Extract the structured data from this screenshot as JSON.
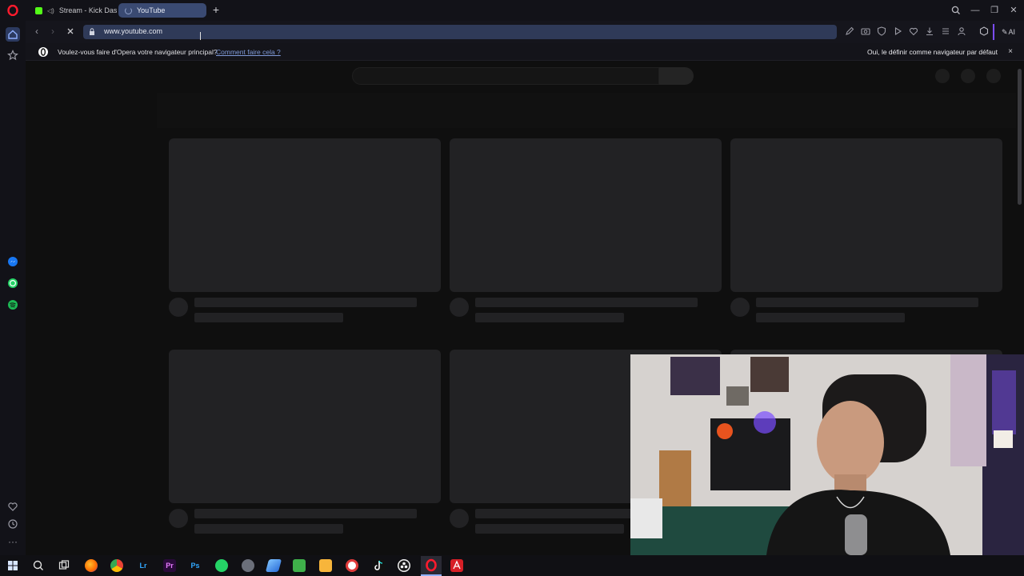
{
  "browser": {
    "tabs": [
      {
        "label": "Stream - Kick Dashbo"
      },
      {
        "label": "YouTube"
      }
    ],
    "address": {
      "url": "www.youtube.com"
    }
  },
  "banner": {
    "message": "Voulez-vous faire d'Opera votre navigateur principal?",
    "link": "Comment faire cela ?",
    "button": "Oui, le définir comme navigateur par défaut",
    "close": "×"
  },
  "toolbar": {
    "ai_label": "AI"
  },
  "taskbar": {
    "apps": [
      "Lr",
      "Pr",
      "Ps"
    ]
  },
  "colors": {
    "opera_red": "#ff1b2d",
    "address_bg": "#2f3a58",
    "active_tab": "#3a4a72",
    "kick_green": "#53fc18",
    "whatsapp_green": "#25d366",
    "spotify_green": "#1db954",
    "messenger_blue": "#1877f2"
  },
  "icons": [
    "opera-logo-icon",
    "home-icon",
    "star-icon",
    "messenger-icon",
    "whatsapp-icon",
    "spotify-icon",
    "heart-icon",
    "history-icon",
    "more-icon",
    "lock-icon",
    "search-icon"
  ]
}
